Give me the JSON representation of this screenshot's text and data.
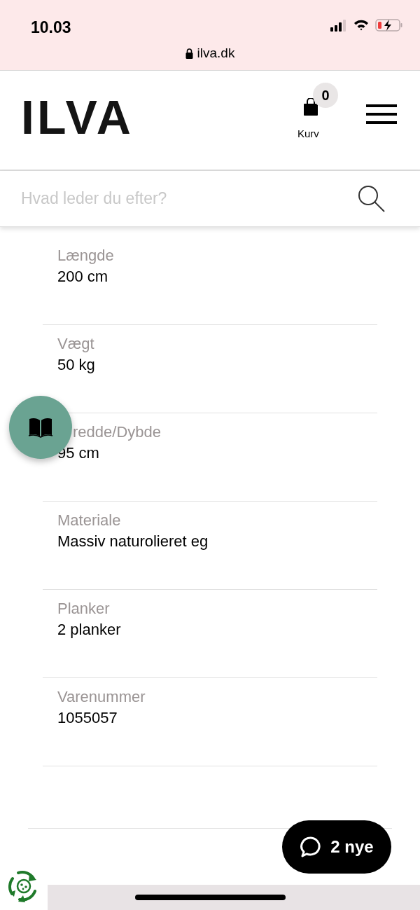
{
  "status_bar": {
    "time": "10.03",
    "url": "ilva.dk"
  },
  "header": {
    "logo": "ILVA",
    "cart": {
      "count": "0",
      "label": "Kurv"
    }
  },
  "search": {
    "placeholder": "Hvad leder du efter?"
  },
  "specs": [
    {
      "label": "Længde",
      "value": "200 cm"
    },
    {
      "label": "Vægt",
      "value": "50 kg"
    },
    {
      "label": "redde/Dybde",
      "value": "95 cm"
    },
    {
      "label": "Materiale",
      "value": "Massiv naturolieret eg"
    },
    {
      "label": "Planker",
      "value": "2 planker"
    },
    {
      "label": "Varenummer",
      "value": "1055057"
    }
  ],
  "chat_button": {
    "label": "2 nye"
  }
}
